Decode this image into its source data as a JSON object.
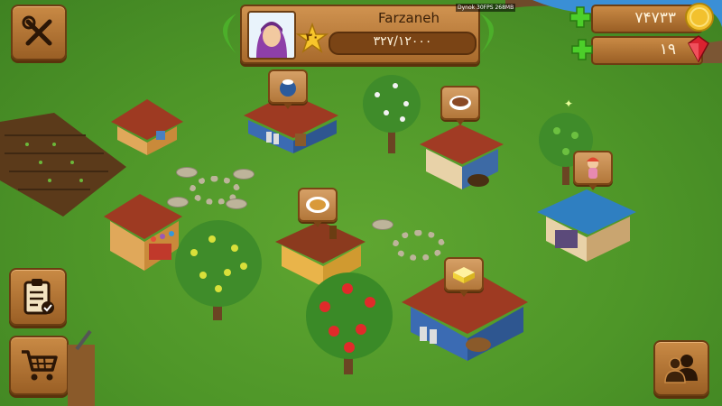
{
  "player": {
    "name": "Farzaneh",
    "level": "۳۰",
    "xp": "۳۲۷/۱۲۰۰۰"
  },
  "resources": {
    "coins": "۷۴۷۳۳",
    "gems": "۱۹"
  },
  "debug": {
    "fps": "Dynok 30FPS 268MB"
  },
  "buttons": {
    "settings": "settings-tools",
    "tasks": "task-list",
    "shop": "shop-cart",
    "friends": "friends"
  },
  "colors": {
    "grass": "#4e9628",
    "wood": "#a86a2c",
    "coin": "#f2c12e",
    "gem": "#d9222f",
    "plus": "#4ccf2a"
  },
  "products": [
    "milk",
    "soup",
    "pastry",
    "doll",
    "butter"
  ]
}
